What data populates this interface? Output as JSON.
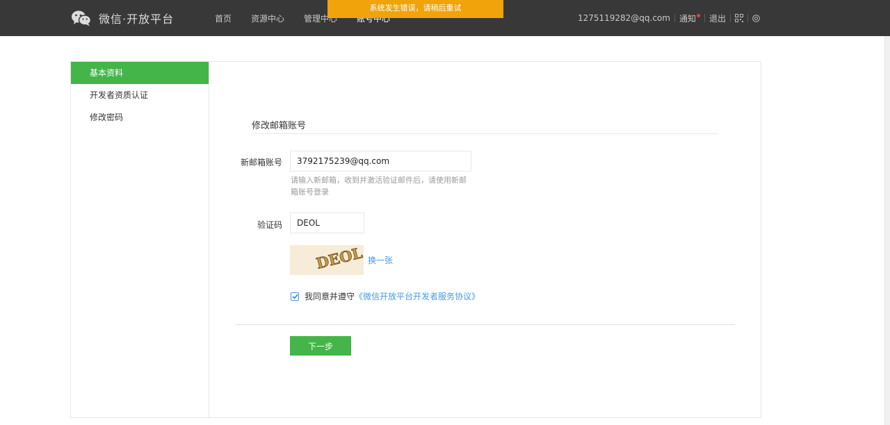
{
  "header": {
    "logo_text": "微信·开放平台",
    "nav": [
      "首页",
      "资源中心",
      "管理中心",
      "账号中心"
    ],
    "active_nav": "账号中心",
    "toast": "系统发生错误，请稍后重试",
    "email": "1275119282@qq.com",
    "notify": "通知",
    "logout": "退出"
  },
  "sidebar": {
    "items": [
      {
        "label": "基本资料",
        "active": true
      },
      {
        "label": "开发者资质认证",
        "active": false
      },
      {
        "label": "修改密码",
        "active": false
      }
    ]
  },
  "form": {
    "title": "修改邮箱账号",
    "email_label": "新邮箱账号",
    "email_value": "3792175239@qq.com",
    "email_tip": "请输入新邮箱，收到并激活验证邮件后，请使用新邮箱账号登录",
    "code_label": "验证码",
    "code_value": "DEOL",
    "captcha_text": "DEOL",
    "refresh": "换一张",
    "agree_text": "我同意并遵守",
    "agree_link": "《微信开放平台开发者服务协议》",
    "agree_checked": true,
    "next_button": "下一步"
  },
  "colors": {
    "topbar": "#383838",
    "accent_green": "#44b549",
    "toast": "#f0a30a",
    "link_blue": "#459ae9"
  }
}
